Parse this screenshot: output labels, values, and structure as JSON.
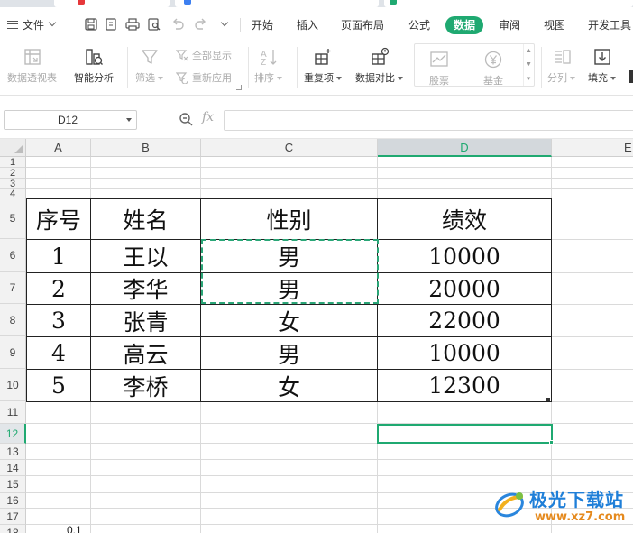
{
  "app": {
    "file_menu_label": "文件",
    "menu_tabs": [
      {
        "label": "开始",
        "active": false
      },
      {
        "label": "插入",
        "active": false
      },
      {
        "label": "页面布局",
        "active": false
      },
      {
        "label": "公式",
        "active": false
      },
      {
        "label": "数据",
        "active": true
      },
      {
        "label": "审阅",
        "active": false
      },
      {
        "label": "视图",
        "active": false
      },
      {
        "label": "开发工具",
        "active": false
      }
    ],
    "accent_color": "#1fa971"
  },
  "ribbon": {
    "pivot_label": "数据透视表",
    "smart_analysis_label": "智能分析",
    "filter_label": "筛选",
    "show_all_label": "全部显示",
    "reapply_label": "重新应用",
    "sort_label": "排序",
    "duplicates_label": "重复项",
    "compare_label": "数据对比",
    "stocks_label": "股票",
    "fund_label": "基金",
    "split_label": "分列",
    "fill_label": "填充"
  },
  "formula_bar": {
    "name_box": "D12",
    "fx_symbol": "fx",
    "formula_value": ""
  },
  "sheet": {
    "columns": [
      "A",
      "B",
      "C",
      "D",
      "E"
    ],
    "selected_column": "D",
    "rows": [
      "1",
      "2",
      "3",
      "4",
      "5",
      "6",
      "7",
      "8",
      "9",
      "10",
      "11",
      "12",
      "13",
      "14",
      "15",
      "16",
      "17",
      "18"
    ],
    "selected_row": "12",
    "table_headers": [
      "序号",
      "姓名",
      "性别",
      "绩效"
    ],
    "table_rows": [
      [
        "1",
        "王以",
        "男",
        "10000"
      ],
      [
        "2",
        "李华",
        "男",
        "20000"
      ],
      [
        "3",
        "张青",
        "女",
        "22000"
      ],
      [
        "4",
        "高云",
        "男",
        "10000"
      ],
      [
        "5",
        "李桥",
        "女",
        "12300"
      ]
    ],
    "row18_b_text": "0.1"
  },
  "watermark": {
    "title": "极光下载站",
    "url": "www.xz7.com"
  }
}
